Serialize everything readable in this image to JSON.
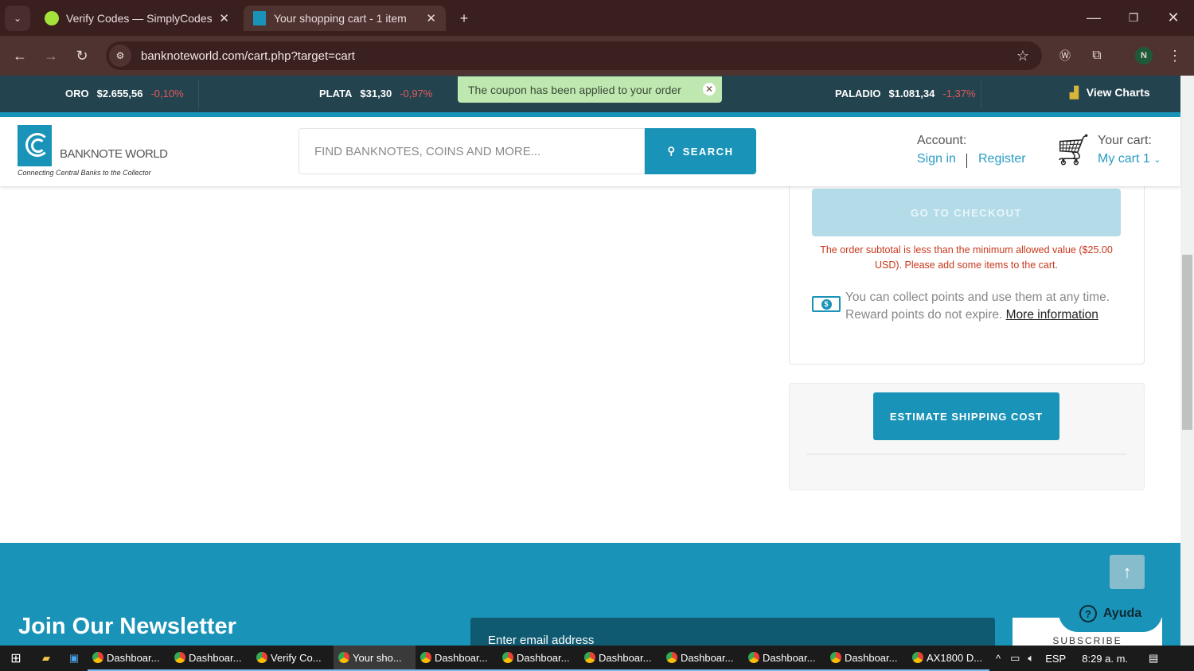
{
  "browser": {
    "tabs": [
      {
        "title": "Verify Codes — SimplyCodes"
      },
      {
        "title": "Your shopping cart - 1 item"
      }
    ],
    "url": "banknoteworld.com/cart.php?target=cart",
    "profile": "N"
  },
  "ticker": {
    "items": [
      {
        "metal": "ORO",
        "price": "$2.655,56",
        "change": "-0,10%"
      },
      {
        "metal": "PLATA",
        "price": "$31,30",
        "change": "-0,97%"
      },
      {
        "metal": "PALADIO",
        "price": "$1.081,34",
        "change": "-1,37%"
      }
    ],
    "view_charts": "View Charts"
  },
  "toast": {
    "message": "The coupon has been applied to your order",
    "close": "✕"
  },
  "header": {
    "logo_name": "BANKNOTE WORLD",
    "logo_tagline": "Connecting Central Banks to the Collector",
    "search_placeholder": "FIND BANKNOTES, COINS AND MORE...",
    "search_button": "SEARCH",
    "account_label": "Account:",
    "sign_in": "Sign in",
    "register": "Register",
    "cart_label": "Your cart:",
    "my_cart": "My cart 1"
  },
  "summary": {
    "checkout": "GO TO CHECKOUT",
    "min_message": "The order subtotal is less than the minimum allowed value ($25.00 USD). Please add some items to the cart.",
    "points_text": "You can collect points and use them at any time. Reward points do not expire.",
    "more_info": "More information"
  },
  "shipping": {
    "button": "ESTIMATE SHIPPING COST"
  },
  "footer": {
    "newsletter": "Join Our Newsletter",
    "email_placeholder": "Enter email address",
    "subscribe": "SUBSCRIBE",
    "help": "Ayuda"
  },
  "taskbar": {
    "items": [
      "Dashboar...",
      "Dashboar...",
      "Verify Co...",
      "Your sho...",
      "Dashboar...",
      "Dashboar...",
      "Dashboar...",
      "Dashboar...",
      "Dashboar...",
      "Dashboar...",
      "AX1800 D..."
    ],
    "lang": "ESP",
    "time": "8:29 a. m."
  },
  "colors": {
    "accent": "#1a93b8",
    "ticker_bg": "#23434f",
    "error": "#c8381c",
    "negative": "#e45a5a"
  }
}
